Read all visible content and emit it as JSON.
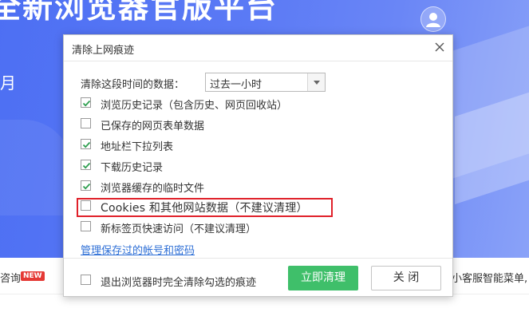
{
  "background": {
    "banner_title": "全新浏览器官版平台",
    "banner_side_text": "月",
    "strip_left_text": "咨询",
    "new_badge": "NEW",
    "strip_right_text": "小客服智能菜单,"
  },
  "dialog": {
    "title": "清除上网痕迹",
    "time_range_label": "清除这段时间的数据：",
    "time_range_value": "过去一小时",
    "options": [
      {
        "label": "浏览历史记录（包含历史、网页回收站）",
        "checked": true
      },
      {
        "label": "已保存的网页表单数据",
        "checked": false
      },
      {
        "label": "地址栏下拉列表",
        "checked": true
      },
      {
        "label": "下载历史记录",
        "checked": true
      },
      {
        "label": "浏览器缓存的临时文件",
        "checked": true
      },
      {
        "label": "Cookies 和其他网站数据（不建议清理）",
        "checked": false
      },
      {
        "label": "新标签页快速访问（不建议清理）",
        "checked": false
      }
    ],
    "manage_link": "管理保存过的帐号和密码",
    "footer_option": {
      "label": "退出浏览器时完全清除勾选的痕迹",
      "checked": false
    },
    "clear_button": "立即清理",
    "close_button": "关 闭"
  },
  "colors": {
    "accent_green": "#3fbf6a",
    "check_green": "#2e9e4f",
    "highlight_red": "#e0212a",
    "link_blue": "#2e6fd6",
    "banner_blue": "#5b7af5"
  }
}
